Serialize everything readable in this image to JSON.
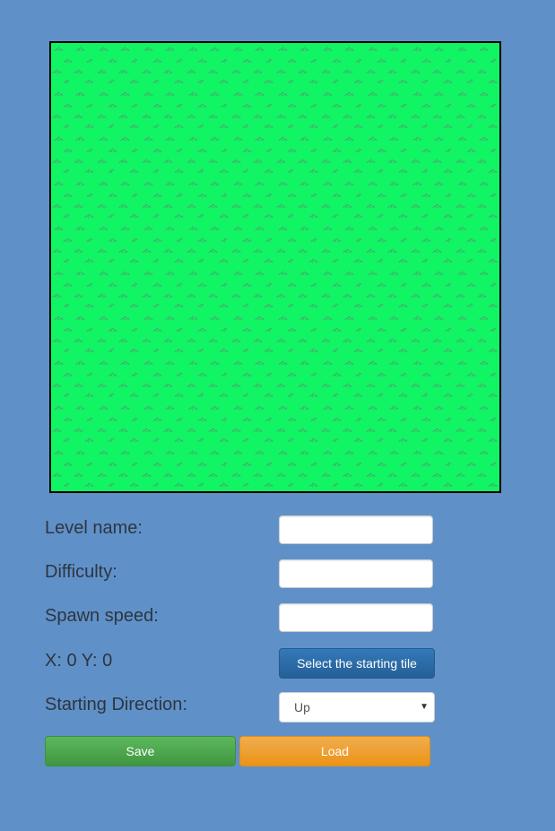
{
  "editor": {
    "map_color": "#11f564",
    "tile_pattern": "grass-tiles"
  },
  "form": {
    "level_name_label": "Level name:",
    "level_name_value": "",
    "difficulty_label": "Difficulty:",
    "difficulty_value": "",
    "spawn_speed_label": "Spawn speed:",
    "spawn_speed_value": "",
    "coords_text": "X: 0 Y: 0",
    "select_tile_button": "Select the starting tile",
    "direction_label": "Starting Direction:",
    "direction_value": "Up"
  },
  "actions": {
    "save_label": "Save",
    "load_label": "Load"
  }
}
